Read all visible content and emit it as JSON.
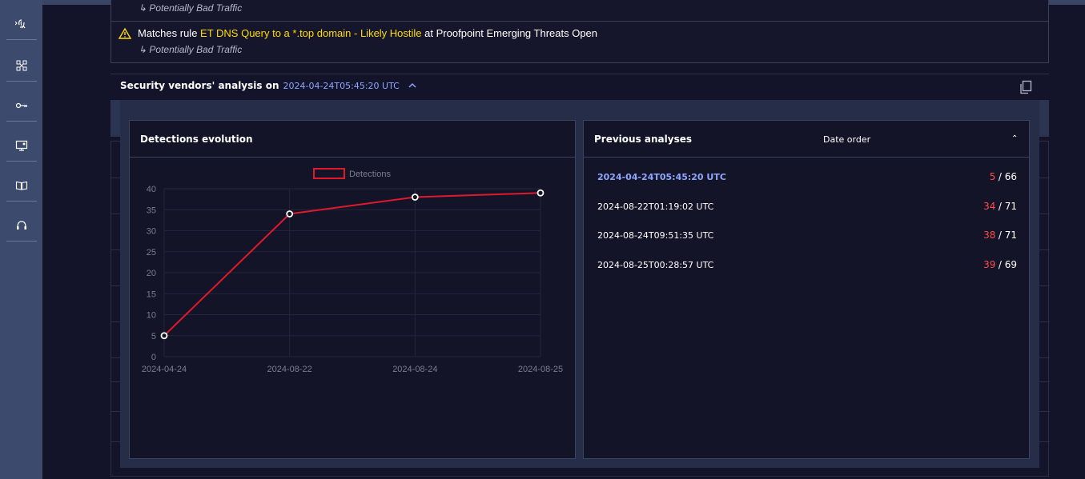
{
  "ids": {
    "top_subcategory": "Potentially Bad Traffic",
    "rule_prefix": "Matches rule",
    "rule_name": "ET DNS Query to a *.top domain - Likely Hostile",
    "rule_at": "at",
    "ruleset": "Proofpoint Emerging Threats Open",
    "subcategory": "Potentially Bad Traffic"
  },
  "section": {
    "title": "Security vendors' analysis on",
    "date": "2024-04-24T05:45:20 UTC"
  },
  "evolution": {
    "title": "Detections evolution"
  },
  "previous": {
    "title": "Previous analyses",
    "sort_label": "Date order",
    "rows": [
      {
        "date": "2024-04-24T05:45:20 UTC",
        "detections": "5",
        "total": "/ 66"
      },
      {
        "date": "2024-08-22T01:19:02 UTC",
        "detections": "34",
        "total": "/ 71"
      },
      {
        "date": "2024-08-24T09:51:35 UTC",
        "detections": "38",
        "total": "/ 71"
      },
      {
        "date": "2024-08-25T00:28:57 UTC",
        "detections": "39",
        "total": "/ 69"
      }
    ]
  },
  "icons": {
    "warning": "warning-icon",
    "copy": "copy-icon",
    "collapse": "chevron-up-icon",
    "sidebar": [
      "fingerprint-icon",
      "network-icon",
      "key-icon",
      "monitor-icon",
      "book-icon",
      "support-icon"
    ]
  },
  "colors": {
    "accent": "#8fa6ff",
    "detection": "#ff4b4b",
    "rule_highlight": "#ffdd00",
    "line": "#e0192b"
  },
  "chart_data": {
    "type": "line",
    "categories": [
      "2024-04-24",
      "2024-08-22",
      "2024-08-24",
      "2024-08-25"
    ],
    "series": [
      {
        "name": "Detections",
        "values": [
          5,
          34,
          38,
          39
        ]
      }
    ],
    "yticks": [
      0,
      5,
      10,
      15,
      20,
      25,
      30,
      35,
      40
    ],
    "ylim": [
      0,
      40
    ],
    "legend": "top-center",
    "grid": true
  }
}
